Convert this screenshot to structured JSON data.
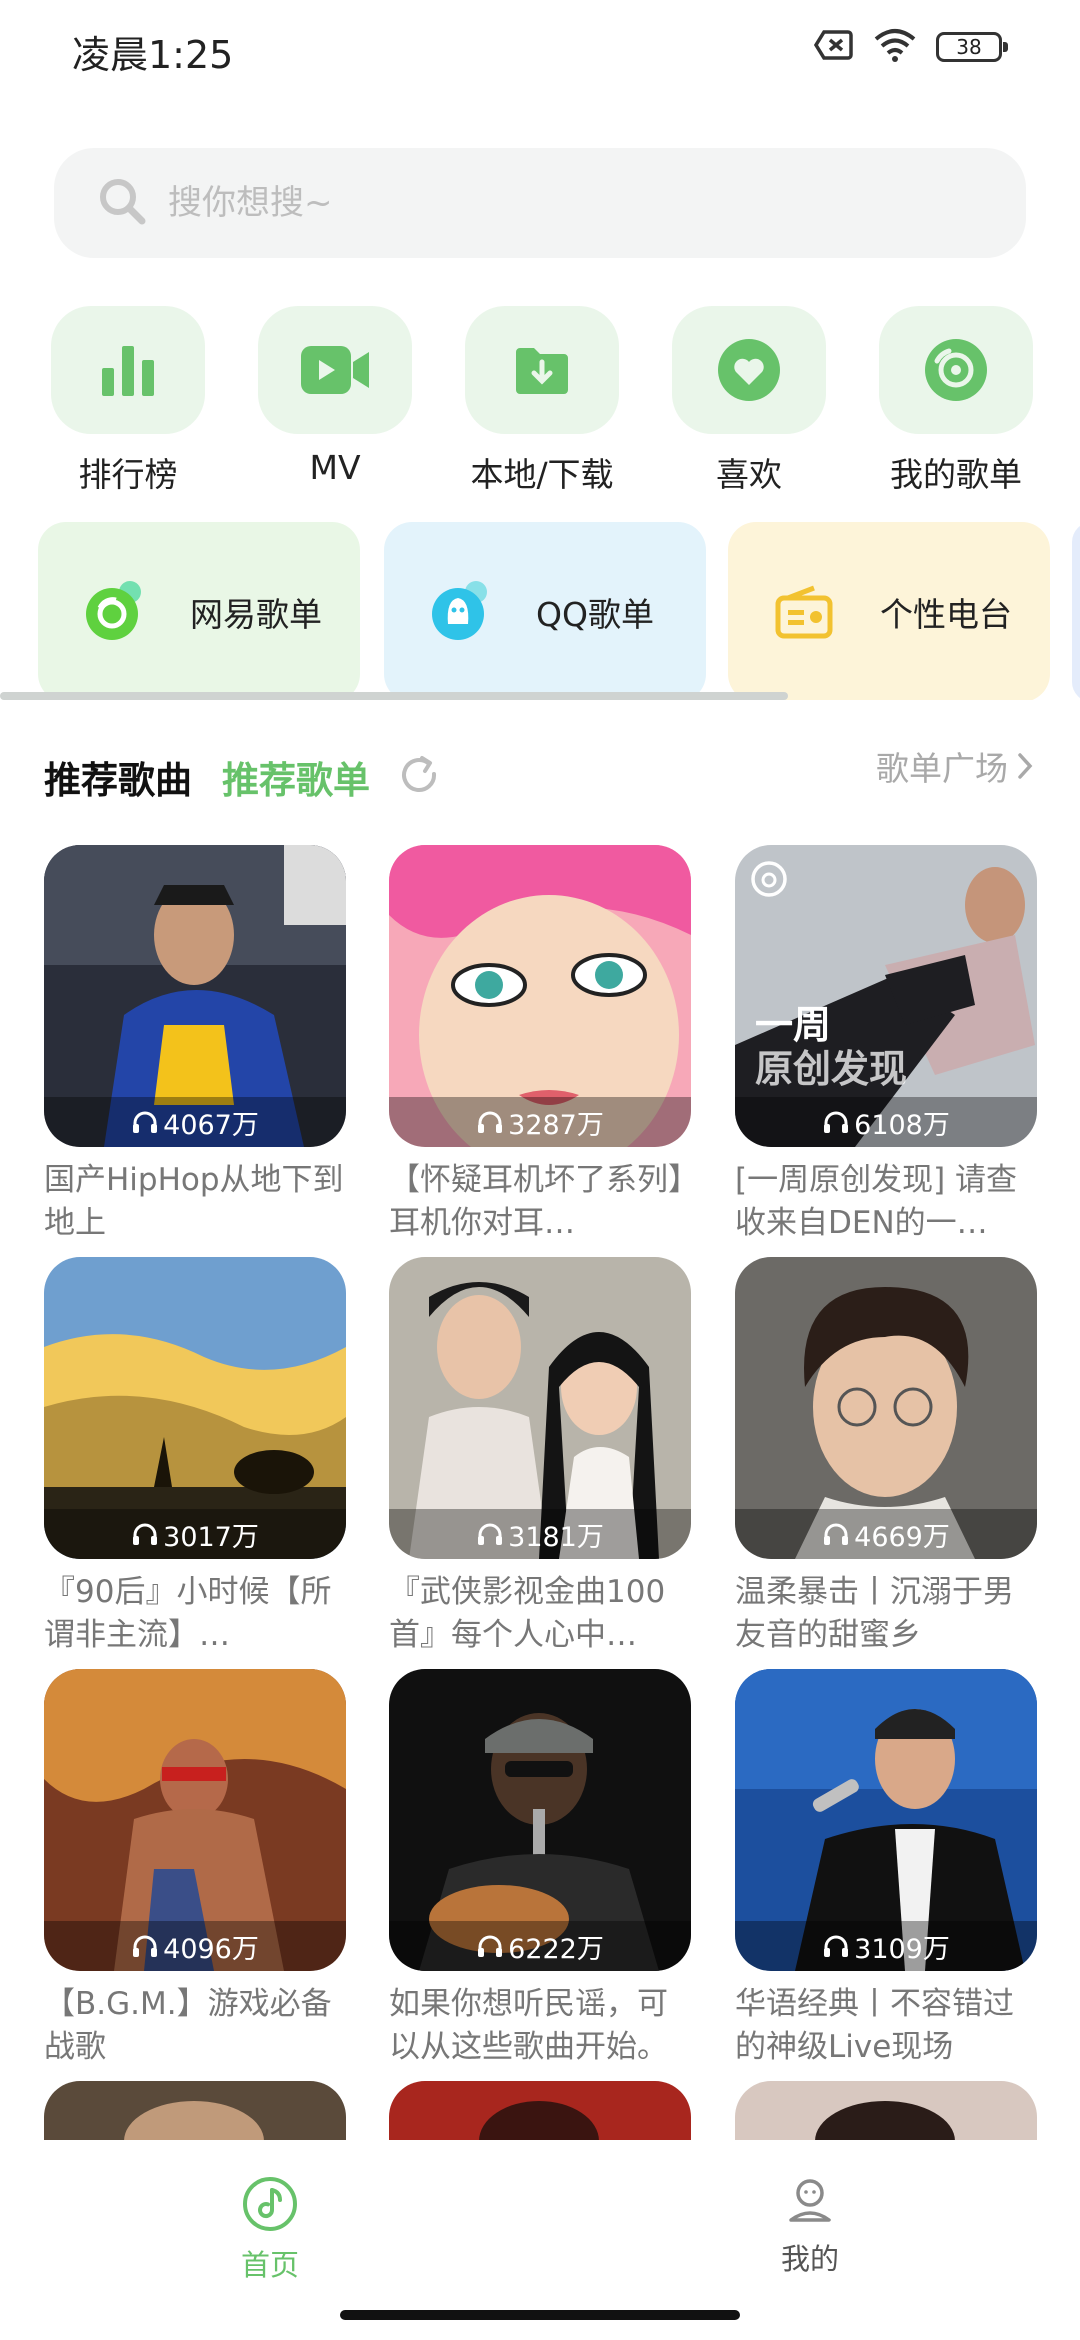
{
  "status_bar": {
    "time": "凌晨1:25",
    "battery": "38",
    "icons": [
      "sim-off-icon",
      "wifi-icon",
      "battery-icon"
    ]
  },
  "search": {
    "placeholder": "搜你想搜~",
    "icon": "search-icon"
  },
  "quick_entries": [
    {
      "label": "排行榜",
      "icon": "bar-chart-icon"
    },
    {
      "label": "MV",
      "icon": "video-icon"
    },
    {
      "label": "本地/下载",
      "icon": "download-folder-icon"
    },
    {
      "label": "喜欢",
      "icon": "heart-icon"
    },
    {
      "label": "我的歌单",
      "icon": "disc-icon"
    }
  ],
  "sources": [
    {
      "label": "网易歌单",
      "icon": "netease-icon",
      "bg": "#e9f7e6"
    },
    {
      "label": "QQ歌单",
      "icon": "qq-icon",
      "bg": "#e3f3fb"
    },
    {
      "label": "个性电台",
      "icon": "radio-icon",
      "bg": "#fdf4d9"
    }
  ],
  "section": {
    "tab_songs": "推荐歌曲",
    "tab_playlists": "推荐歌单",
    "plaza_link": "歌单广场"
  },
  "playlists": [
    {
      "plays": "4067万",
      "title": "国产HipHop从地下到地上"
    },
    {
      "plays": "3287万",
      "title": "【怀疑耳机坏了系列】耳机你对耳…"
    },
    {
      "plays": "6108万",
      "title": "[一周原创发现] 请查收来自DEN的一…",
      "overlay_line1": "一周",
      "overlay_line2": "原创发现"
    },
    {
      "plays": "3017万",
      "title": "『90后』小时候【所谓非主流】…"
    },
    {
      "plays": "3181万",
      "title": "『武侠影视金曲100首』每个人心中…"
    },
    {
      "plays": "4669万",
      "title": "温柔暴击丨沉溺于男友音的甜蜜乡"
    },
    {
      "plays": "4096万",
      "title": "【B.G.M.】游戏必备战歌"
    },
    {
      "plays": "6222万",
      "title": "如果你想听民谣，可以从这些歌曲开始。"
    },
    {
      "plays": "3109万",
      "title": "华语经典丨不容错过的神级Live现场"
    }
  ],
  "bottom_nav": {
    "home": "首页",
    "mine": "我的"
  },
  "colors": {
    "accent": "#67c26a",
    "tile_bg": "#eaf6ea",
    "search_bg": "#f3f4f4"
  }
}
